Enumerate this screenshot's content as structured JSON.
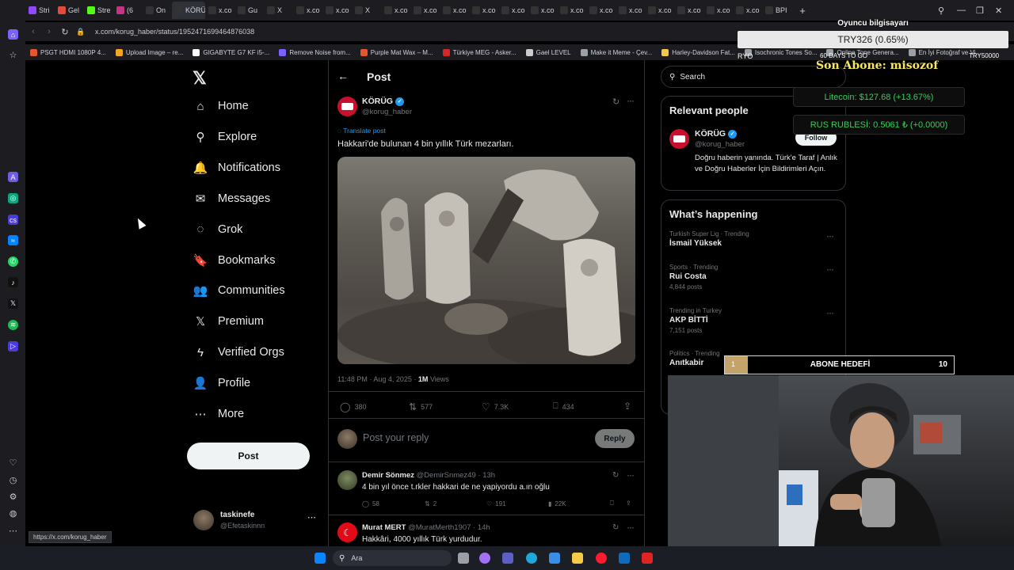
{
  "browser": {
    "tabs": [
      {
        "label": "Stri",
        "color": "#9146ff"
      },
      {
        "label": "Gel",
        "color": "#e24a3b"
      },
      {
        "label": "Stre",
        "color": "#53fc18"
      },
      {
        "label": "(6",
        "color": "#c13584"
      },
      {
        "label": "On",
        "color": "#333"
      },
      {
        "label": "KÖRÜG",
        "color": "#333",
        "active": true
      },
      {
        "label": "x.co",
        "color": "#333"
      },
      {
        "label": "Gu",
        "color": "#333"
      },
      {
        "label": "X",
        "color": "#333"
      },
      {
        "label": "x.co",
        "color": "#333"
      },
      {
        "label": "x.co",
        "color": "#333"
      },
      {
        "label": "X",
        "color": "#333"
      },
      {
        "label": "x.co",
        "color": "#333"
      },
      {
        "label": "x.co",
        "color": "#333"
      },
      {
        "label": "x.co",
        "color": "#333"
      },
      {
        "label": "x.co",
        "color": "#333"
      },
      {
        "label": "x.co",
        "color": "#333"
      },
      {
        "label": "x.co",
        "color": "#333"
      },
      {
        "label": "x.co",
        "color": "#333"
      },
      {
        "label": "x.co",
        "color": "#333"
      },
      {
        "label": "x.co",
        "color": "#333"
      },
      {
        "label": "x.co",
        "color": "#333"
      },
      {
        "label": "x.co",
        "color": "#333"
      },
      {
        "label": "x.co",
        "color": "#333"
      },
      {
        "label": "x.co",
        "color": "#333"
      },
      {
        "label": "BPI",
        "color": "#333"
      }
    ],
    "url": "x.com/korug_haber/status/1952471699464876038",
    "bookmarks": [
      {
        "label": "PSGT HDMI 1080P 4...",
        "color": "#e4572e"
      },
      {
        "label": "Upload Image – re...",
        "color": "#f5a623"
      },
      {
        "label": "GIGABYTE G7 KF i5-...",
        "color": "#ffffff"
      },
      {
        "label": "Remove Noise from...",
        "color": "#7b61ff"
      },
      {
        "label": "Purple Mat Wax – M...",
        "color": "#e4572e"
      },
      {
        "label": "Türkiye MEG - Asker...",
        "color": "#d62828"
      },
      {
        "label": "Gael LEVEL",
        "color": "#cccccc"
      },
      {
        "label": "Make it Meme - Çev...",
        "color": "#9aa0a6"
      },
      {
        "label": "Harley-Davidson Fat...",
        "color": "#f2c94c"
      },
      {
        "label": "Isochronic Tones So...",
        "color": "#9aa0a6"
      },
      {
        "label": "Online Tone Genera...",
        "color": "#9aa0a6"
      },
      {
        "label": "En İyi Fotoğraf ve Vi...",
        "color": "#9aa0a6"
      }
    ],
    "status_url": "https://x.com/korug_haber"
  },
  "nav": {
    "items": [
      {
        "label": "Home",
        "icon": "home-icon",
        "glyph": "⌂"
      },
      {
        "label": "Explore",
        "icon": "search-icon",
        "glyph": "⚲"
      },
      {
        "label": "Notifications",
        "icon": "bell-icon",
        "glyph": "🔔"
      },
      {
        "label": "Messages",
        "icon": "envelope-icon",
        "glyph": "✉"
      },
      {
        "label": "Grok",
        "icon": "grok-icon",
        "glyph": "◌"
      },
      {
        "label": "Bookmarks",
        "icon": "bookmark-icon",
        "glyph": "🔖"
      },
      {
        "label": "Communities",
        "icon": "people-icon",
        "glyph": "👥"
      },
      {
        "label": "Premium",
        "icon": "x-logo-icon",
        "glyph": "𝕏"
      },
      {
        "label": "Verified Orgs",
        "icon": "lightning-icon",
        "glyph": "ϟ"
      },
      {
        "label": "Profile",
        "icon": "person-icon",
        "glyph": "👤"
      },
      {
        "label": "More",
        "icon": "more-circle-icon",
        "glyph": "⋯"
      }
    ],
    "post_button": "Post",
    "account": {
      "name": "taskinefe",
      "handle": "@Efetaskinnn"
    }
  },
  "post": {
    "header_title": "Post",
    "author_name": "KÖRÜG",
    "author_handle": "@korug_haber",
    "translate": "Translate post",
    "text": "Hakkari'de bulunan 4 bin yıllık Türk mezarları.",
    "timestamp": "11:48 PM · Aug 4, 2025 ·",
    "views_count": "1M",
    "views_label": "Views",
    "replies": "380",
    "reposts": "577",
    "likes": "7.3K",
    "bookmarks": "434",
    "reply_placeholder": "Post your reply",
    "reply_button": "Reply"
  },
  "replies": [
    {
      "name": "Demir Sönmez",
      "handle": "@DemirSnmez49",
      "time": "· 13h",
      "text": "4 bin yıl önce t.rkler hakkari de ne yapiyordu a.ın oğlu",
      "replies": "58",
      "reposts": "2",
      "likes": "191",
      "views": "22K"
    },
    {
      "name": "Murat MERT",
      "handle": "@MuratMerth1907",
      "time": "· 14h",
      "text": "Hakkâri, 4000 yıllık Türk yurdudur."
    }
  ],
  "right": {
    "search_placeholder": "Search",
    "relevant_title": "Relevant people",
    "person_name": "KÖRÜG",
    "person_handle": "@korug_haber",
    "follow": "Follow",
    "bio": "Doğru haberin yanında. Türk'e Taraf | Anlık ve Doğru Haberler İçin Bildirimleri Açın.",
    "happening_title": "What’s happening",
    "trends": [
      {
        "category": "Turkish Super Lig · Trending",
        "title": "İsmail Yüksek",
        "posts": ""
      },
      {
        "category": "Sports · Trending",
        "title": "Rui Costa",
        "posts": "4,844 posts"
      },
      {
        "category": "Trending in Turkey",
        "title": "AKP BİTTİ",
        "posts": "7,151 posts"
      },
      {
        "category": "Politics · Trending",
        "title": "Anıtkabir",
        "posts": ""
      }
    ]
  },
  "overlay": {
    "pc_title": "Oyuncu bilgisayarı",
    "try_value": "TRY326 (0.65%)",
    "ryo": "RYO",
    "days": "60 DAYS TO GO",
    "try_target": "TRY50000",
    "last_sub": "Son Abone: misozof",
    "litecoin": "Litecoin: $127.68 (+13.67%)",
    "ruble": "RUS RUBLESİ: 0.5061 ₺ (+0.0000)",
    "goal_current": "1",
    "goal_label": "ABONE HEDEFİ",
    "goal_target": "10",
    "goal_progress": 0.1
  },
  "taskbar": {
    "search": "Ara"
  }
}
